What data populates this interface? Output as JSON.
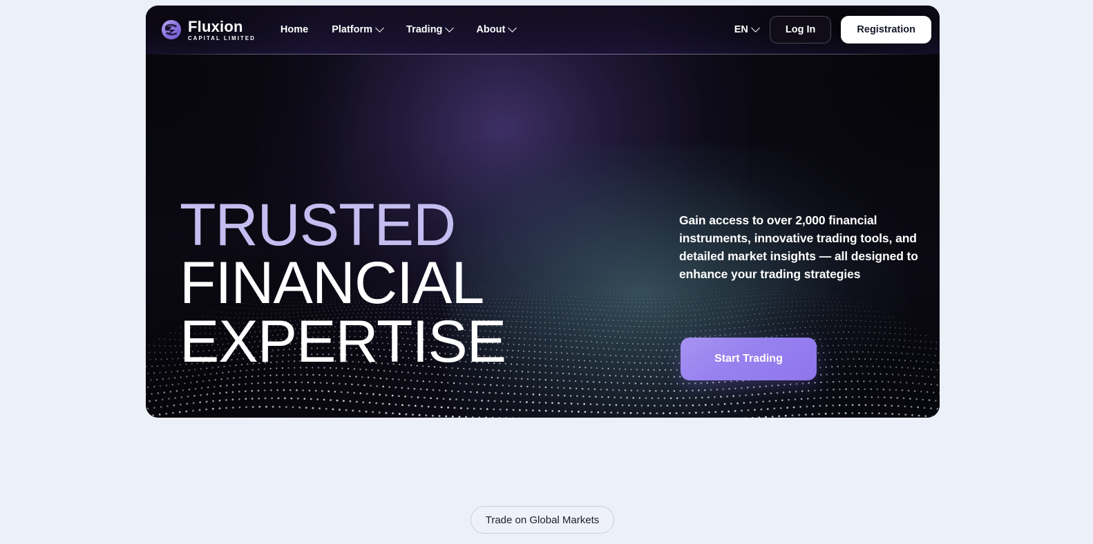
{
  "page": {
    "background_color": "#ecf0f9"
  },
  "hero": {
    "background_color": "#0c0a14",
    "accent_purple": "#9781ef",
    "headline_accent_color": "#c3bdf0",
    "headline": {
      "line1": "TRUSTED",
      "line2": "FINANCIAL",
      "line3": "EXPERTISE"
    },
    "paragraph": "Gain access to over 2,000 financial instruments, innovative trading tools, and detailed market insights — all designed to enhance your trading strategies",
    "cta_label": "Start Trading"
  },
  "nav": {
    "logo": {
      "icon": "fluxion-swirl-logo-icon",
      "word": "Fluxion",
      "subtitle": "CAPITAL LIMITED"
    },
    "links": [
      {
        "label": "Home",
        "has_dropdown": false
      },
      {
        "label": "Platform",
        "has_dropdown": true
      },
      {
        "label": "Trading",
        "has_dropdown": true
      },
      {
        "label": "About",
        "has_dropdown": true
      }
    ],
    "language": {
      "label": "EN",
      "icon": "chevron-down-icon"
    },
    "login_label": "Log In",
    "registration_label": "Registration"
  },
  "below": {
    "pill_label": "Trade on Global Markets"
  }
}
